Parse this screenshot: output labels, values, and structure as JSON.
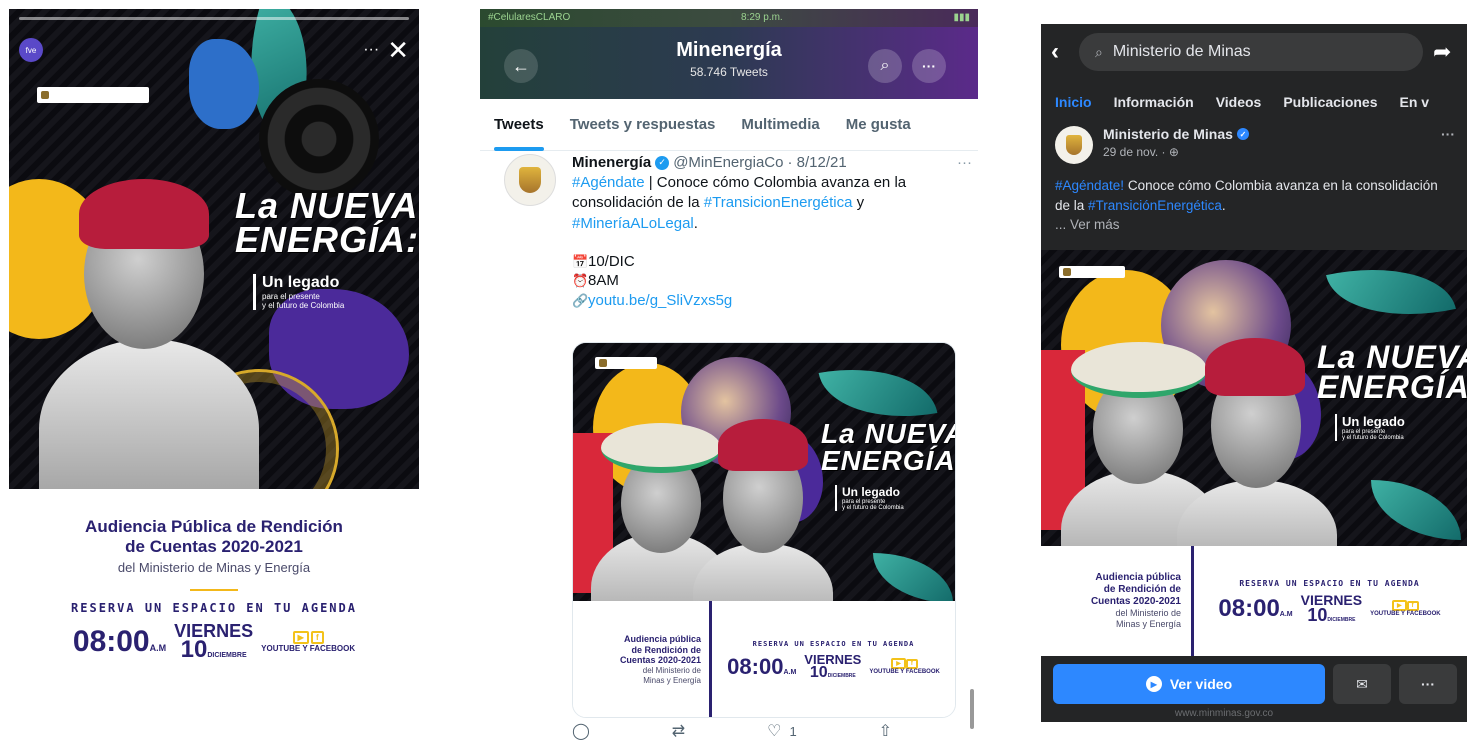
{
  "poster": {
    "title_line1": "La NUEVA",
    "title_line2": "ENERGÍA:",
    "subtitle_line1": "Un legado",
    "subtitle_line2": "para el presente",
    "subtitle_line3": "y el futuro de Colombia",
    "audiencia_line1": "Audiencia Pública de Rendición",
    "audiencia_line2": "de Cuentas 2020-2021",
    "ministerio": "del Ministerio de Minas y Energía",
    "reserve": "RESERVA UN ESPACIO EN TU AGENDA",
    "time": "08:00",
    "time_suffix": "A.M",
    "day_name": "VIERNES",
    "day_number": "10",
    "month": "DICIEMBRE",
    "platforms": "YOUTUBE Y FACEBOOK"
  },
  "story": {
    "close_icon": "✕",
    "more_label": "···"
  },
  "twitter": {
    "status_left": "#CelularesCLARO",
    "status_time": "8:29 p.m.",
    "header_title": "Minenergía",
    "header_subtitle": "58.746 Tweets",
    "tabs": [
      {
        "label": "Tweets"
      },
      {
        "label": "Tweets y respuestas"
      },
      {
        "label": "Multimedia"
      },
      {
        "label": "Me gusta"
      }
    ],
    "tweet": {
      "name": "Minenergía",
      "handle": "@MinEnergiaCo",
      "date": "· 8/12/21",
      "hashtag1": "#Agéndate",
      "text1": " | Conoce cómo Colombia avanza en la consolidación de la ",
      "hashtag2": "#TransicionEnergética",
      "text2": " y ",
      "hashtag3": "#MineríaALoLegal",
      "text3": ".",
      "line_date": "10/DIC",
      "line_time": "8AM",
      "line_link": "youtu.be/g_SliVzxs5g",
      "card_audiencia_1": "Audiencia pública",
      "card_audiencia_2": "de Rendición de",
      "card_audiencia_3": "Cuentas 2020-2021",
      "card_del_1": "del Ministerio de",
      "card_del_2": "Minas y Energía"
    },
    "actions": {
      "likes": "1"
    }
  },
  "facebook": {
    "search_value": "Ministerio de Minas",
    "tabs": [
      {
        "label": "Inicio"
      },
      {
        "label": "Información"
      },
      {
        "label": "Videos"
      },
      {
        "label": "Publicaciones"
      },
      {
        "label": "En v"
      }
    ],
    "post": {
      "page_name": "Ministerio de Minas",
      "date": "29 de nov. · ",
      "hashtag1": "#Agéndate!",
      "text1": " Conoce cómo Colombia avanza en la consolidación de la ",
      "hashtag2": "#TransiciónEnergética",
      "text2": ".",
      "see_more": "... Ver más"
    },
    "cta_label": "Ver video",
    "footer_link": "www.minminas.gov.co"
  },
  "colors": {
    "twitter_accent": "#1d9bf0",
    "facebook_accent": "#2d88ff",
    "poster_navy": "#2a2170",
    "poster_yellow": "#f3b81a"
  }
}
